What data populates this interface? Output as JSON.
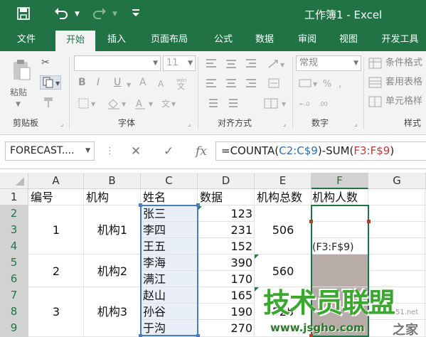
{
  "window": {
    "title": "工作簿1 - Excel"
  },
  "qat": {
    "save_icon": "save-icon",
    "undo_icon": "undo-icon",
    "redo_icon": "redo-icon",
    "more_icon": "customize-icon"
  },
  "tabs": [
    {
      "label": "文件"
    },
    {
      "label": "开始"
    },
    {
      "label": "插入"
    },
    {
      "label": "页面布局"
    },
    {
      "label": "公式"
    },
    {
      "label": "数据"
    },
    {
      "label": "审阅"
    },
    {
      "label": "视图"
    },
    {
      "label": "开发工具"
    }
  ],
  "active_tab": "开始",
  "ribbon": {
    "clipboard": {
      "label": "剪贴板",
      "paste": "粘贴"
    },
    "font": {
      "label": "字体",
      "size": "11",
      "bold": "B",
      "italic": "I",
      "underline": "U"
    },
    "alignment": {
      "label": "对齐方式"
    },
    "number": {
      "label": "数字",
      "format": "常规",
      "percent": "%"
    },
    "styles": {
      "label": "样式",
      "conditional": "条件格式",
      "table": "套用表格",
      "cell_styles": "单元格样"
    }
  },
  "formula_bar": {
    "namebox": "FORECAST....",
    "formula_parts": [
      "=COUNTA(",
      "C2:C$9",
      ")-SUM(",
      "F3:F$9",
      ")"
    ]
  },
  "columns": [
    "A",
    "B",
    "C",
    "D",
    "E",
    "F",
    "G"
  ],
  "rows": [
    "1",
    "2",
    "3",
    "4",
    "5",
    "6",
    "7",
    "8",
    "9"
  ],
  "sheet": {
    "headers": {
      "a": "编号",
      "b": "机构",
      "c": "姓名",
      "d": "数据",
      "e": "机构总数",
      "f": "机构人数"
    },
    "groups": [
      {
        "id": "1",
        "org": "机构1",
        "total": "506"
      },
      {
        "id": "2",
        "org": "机构2",
        "total": "560"
      },
      {
        "id": "3",
        "org": "机构3",
        "total": "525"
      }
    ],
    "names": [
      "张三",
      "李四",
      "王五",
      "李海",
      "满江",
      "赵山",
      "孙谷",
      "于沟"
    ],
    "values": [
      "123",
      "231",
      "152",
      "390",
      "170",
      "165",
      "190",
      "270"
    ],
    "edit_hint": "(F3:F$9)"
  },
  "colors": {
    "excel_green": "#217346",
    "selection_fill": "#e9eff8",
    "edit_fill": "#b8aca8"
  },
  "watermark": {
    "text": "技术员联盟",
    "site": "www.jsgho.com",
    "site2": "51.net",
    "brand": "之家"
  }
}
